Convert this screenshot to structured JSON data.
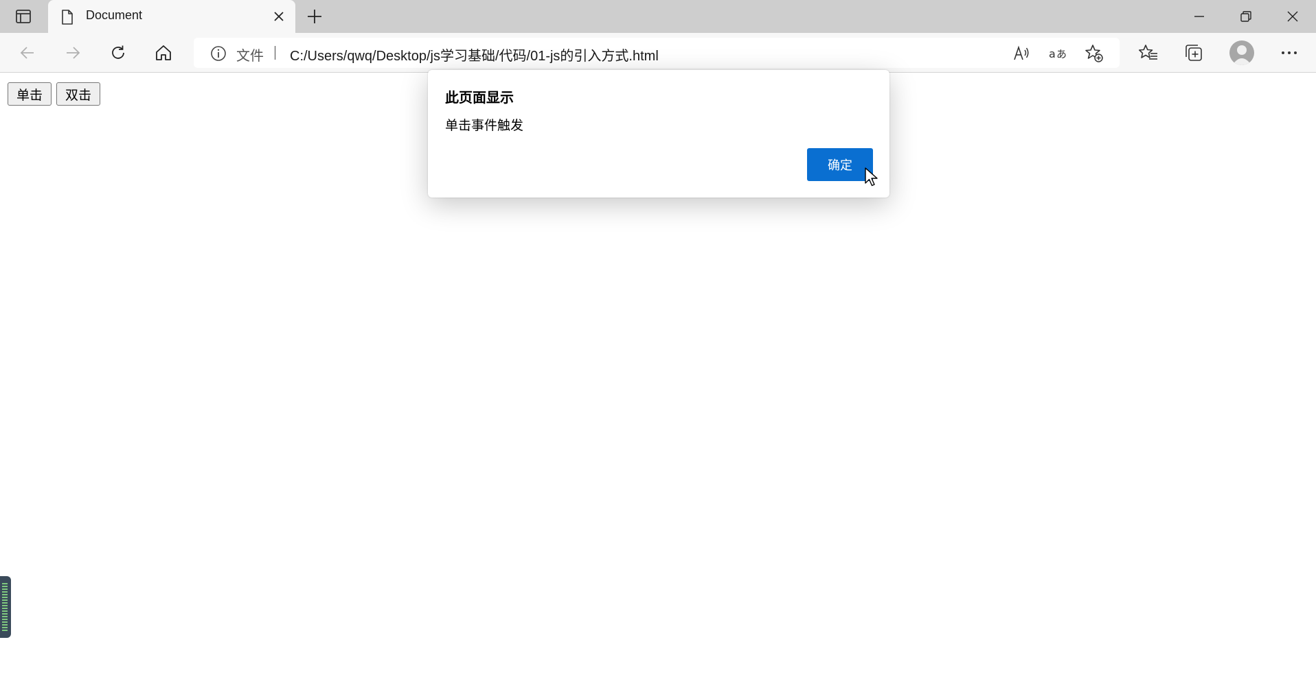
{
  "tab": {
    "title": "Document"
  },
  "address_bar": {
    "label": "文件",
    "url": "C:/Users/qwq/Desktop/js学习基础/代码/01-js的引入方式.html"
  },
  "page": {
    "buttons": [
      {
        "label": "单击"
      },
      {
        "label": "双击"
      }
    ]
  },
  "dialog": {
    "title": "此页面显示",
    "message": "单击事件触发",
    "ok_label": "确定"
  },
  "colors": {
    "accent": "#0a6fd1",
    "tabstrip": "#cecece",
    "toolbar": "#f7f7f7"
  }
}
